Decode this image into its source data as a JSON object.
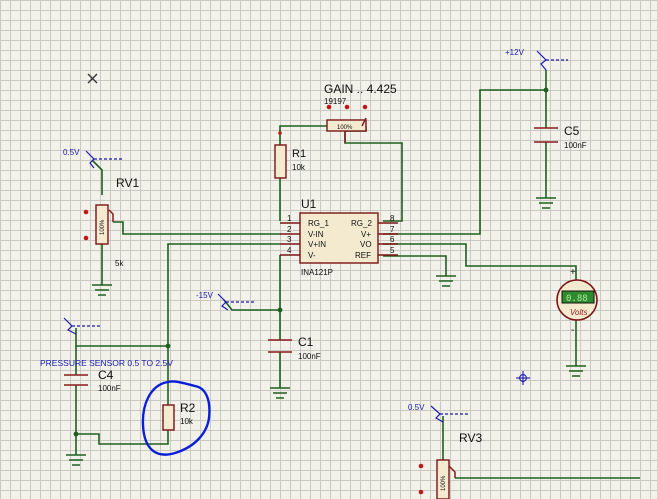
{
  "labels": {
    "gain": "GAIN .. 4.425",
    "gain_value": "19197",
    "rv1": "RV1",
    "rv1_value": "5k",
    "rv3": "RV3",
    "r1": "R1",
    "r1_value": "10k",
    "r2": "R2",
    "r2_value": "10k",
    "u1": "U1",
    "u1_part": "INA121P",
    "c1": "C1",
    "c1_value": "100nF",
    "c4": "C4",
    "c4_value": "100nF",
    "c5": "C5",
    "c5_value": "100nF",
    "pressure": "PRESSURE SENSOR 0.5 TO 2.5V"
  },
  "probes": {
    "v12": "+12V",
    "v05_top": "0.5V",
    "vm15": "-15V",
    "v05_bottom": "0.5V"
  },
  "ic": {
    "pins_left": [
      "RG_1",
      "V-IN",
      "V+IN",
      "V-"
    ],
    "pins_left_num": [
      "1",
      "2",
      "3",
      "4"
    ],
    "pins_right": [
      "RG_2",
      "V+",
      "VO",
      "REF"
    ],
    "pins_right_num": [
      "8",
      "7",
      "6",
      "5"
    ]
  },
  "pot": {
    "percent": "100%"
  },
  "meter": {
    "reading": "0.88",
    "unit": "Volts",
    "plus": "+",
    "minus": "-"
  }
}
